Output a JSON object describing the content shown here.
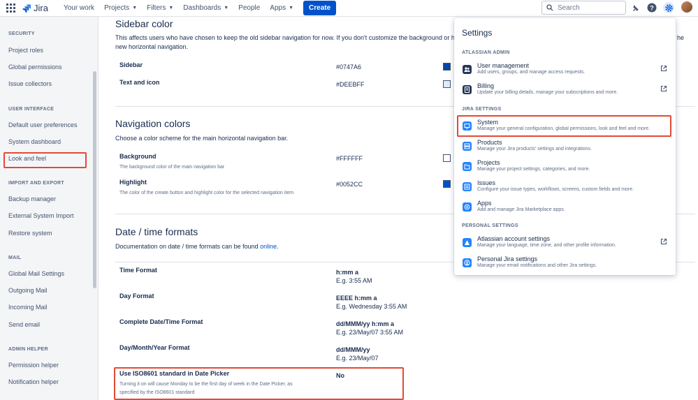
{
  "topbar": {
    "logo": "Jira",
    "nav": [
      "Your work",
      "Projects",
      "Filters",
      "Dashboards",
      "People",
      "Apps"
    ],
    "nav_dropdown": [
      false,
      true,
      true,
      true,
      false,
      true
    ],
    "create": "Create",
    "search_placeholder": "Search"
  },
  "sidebar": {
    "sections": [
      {
        "title": "SECURITY",
        "items": [
          "Project roles",
          "Global permissions",
          "Issue collectors"
        ]
      },
      {
        "title": "USER INTERFACE",
        "items": [
          "Default user preferences",
          "System dashboard",
          "Look and feel"
        ]
      },
      {
        "title": "IMPORT AND EXPORT",
        "items": [
          "Backup manager",
          "External System Import",
          "Restore system"
        ]
      },
      {
        "title": "MAIL",
        "items": [
          "Global Mail Settings",
          "Outgoing Mail",
          "Incoming Mail",
          "Send email"
        ]
      },
      {
        "title": "ADMIN HELPER",
        "items": [
          "Permission helper",
          "Notification helper"
        ]
      }
    ],
    "selected": "Look and feel"
  },
  "main": {
    "sidebar_color": {
      "title": "Sidebar color",
      "desc_line1": "This affects users who have chosen to keep the old sidebar navigation for now. If you don't customize the background or hig",
      "desc_line1_tail": "he",
      "desc_line2": "new horizontal navigation.",
      "rows": [
        {
          "label": "Sidebar",
          "value": "#0747A6",
          "color": "#0747A6"
        },
        {
          "label": "Text and icon",
          "value": "#DEEBFF",
          "color": "#DEEBFF"
        }
      ]
    },
    "navigation_colors": {
      "title": "Navigation colors",
      "desc": "Choose a color scheme for the main horizontal navigation bar.",
      "rows": [
        {
          "label": "Background",
          "sub": "The background color of the main navigation bar",
          "value": "#FFFFFF",
          "color": "#FFFFFF"
        },
        {
          "label": "Highlight",
          "sub": "The color of the create button and highlight color for the selected navigation item",
          "value": "#0052CC",
          "color": "#0052CC"
        }
      ]
    },
    "date_formats": {
      "title": "Date / time formats",
      "desc_prefix": "Documentation on date / time formats can be found ",
      "desc_link": "online",
      "desc_suffix": ".",
      "rows": [
        {
          "label": "Time Format",
          "value": "h:mm a",
          "example": "E.g. 3:55 AM"
        },
        {
          "label": "Day Format",
          "value": "EEEE h:mm a",
          "example": "E.g. Wednesday 3:55 AM"
        },
        {
          "label": "Complete Date/Time Format",
          "value": "dd/MMM/yy h:mm a",
          "example": "E.g. 23/May/07 3:55 AM"
        },
        {
          "label": "Day/Month/Year Format",
          "value": "dd/MMM/yy",
          "example": "E.g. 23/May/07"
        }
      ],
      "iso": {
        "label": "Use ISO8601 standard in Date Picker",
        "sub1": "Turning it on will cause Monday to be the first day of week in the Date Picker, as",
        "sub2": "specified by the ISO8601 standard",
        "value": "No"
      }
    }
  },
  "settings": {
    "title": "Settings",
    "sections": [
      {
        "title": "ATLASSIAN ADMIN",
        "items": [
          {
            "name": "User management",
            "desc": "Add users, groups, and manage access requests.",
            "icon": "users-icon",
            "external": true
          },
          {
            "name": "Billing",
            "desc": "Update your billing details, manage your subscriptions and more.",
            "icon": "billing-icon",
            "external": true
          }
        ]
      },
      {
        "title": "JIRA SETTINGS",
        "items": [
          {
            "name": "System",
            "desc": "Manage your general configuration, global permissions, look and feel and more.",
            "icon": "monitor-icon",
            "external": false
          },
          {
            "name": "Products",
            "desc": "Manage your Jira products' settings and integrations.",
            "icon": "products-icon",
            "external": false
          },
          {
            "name": "Projects",
            "desc": "Manage your project settings, categories, and more.",
            "icon": "folder-icon",
            "external": false
          },
          {
            "name": "Issues",
            "desc": "Configure your issue types, workflows, screens, custom fields and more.",
            "icon": "issues-icon",
            "external": false
          },
          {
            "name": "Apps",
            "desc": "Add and manage Jira Marketplace apps.",
            "icon": "apps-icon",
            "external": false
          }
        ]
      },
      {
        "title": "PERSONAL SETTINGS",
        "items": [
          {
            "name": "Atlassian account settings",
            "desc": "Manage your language, time zone, and other profile information.",
            "icon": "atlassian-icon",
            "external": true
          },
          {
            "name": "Personal Jira settings",
            "desc": "Manage your email notifications and other Jira settings.",
            "icon": "person-icon",
            "external": false
          }
        ]
      }
    ],
    "highlighted": "System"
  }
}
